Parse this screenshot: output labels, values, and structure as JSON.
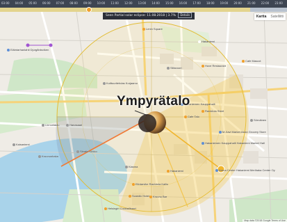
{
  "timeline": {
    "ticks": [
      "03:00",
      "04:00",
      "05:00",
      "06:00",
      "07:00",
      "08:00",
      "09:00",
      "10:00",
      "11:00",
      "12:00",
      "13:00",
      "14:00",
      "15:00",
      "16:00",
      "17:00",
      "18:00",
      "19:00",
      "20:00",
      "21:00",
      "22:00",
      "23:00"
    ],
    "position": 0.31
  },
  "eclipse": {
    "text": "Seen Partial solar eclipse: 11.08.2018 | 3.7%",
    "button": "Details"
  },
  "map_type": {
    "map": "Kartta",
    "satellite": "Satelliitti"
  },
  "place_title": "Ympyrätalo",
  "attribution": "Map data ©2018 Google  Terms of Use",
  "pois": [
    {
      "name": "Lenin Square",
      "color": "#f0a02c"
    },
    {
      "name": "Hakaniemi",
      "color": "#ffffff"
    },
    {
      "name": "Cafe Mascot",
      "color": "#f0a02c"
    },
    {
      "name": "Siltavuori",
      "color": "#999"
    },
    {
      "name": "Huve Restaurant",
      "color": "#f0a02c"
    },
    {
      "name": "Kulttuuritehdas Korjaamo",
      "color": "#999"
    },
    {
      "name": "Hakaniemen Kauppahalli",
      "color": "#5e8fd6"
    },
    {
      "name": "Cafe Talo",
      "color": "#f0a02c"
    },
    {
      "name": "Ravintola Steet",
      "color": "#f0a02c"
    },
    {
      "name": "Sörnäinen",
      "color": "#999"
    },
    {
      "name": "M-Xavi Market Asian Grocery Store",
      "color": "#5e8fd6"
    },
    {
      "name": "Hakaniemen Kauppahalli Hakaniemi Market Hall",
      "color": "#5e8fd6"
    },
    {
      "name": "Arena Center Hakaniemi Merihaka Center Oy",
      "color": "#5e8fd6"
    },
    {
      "name": "Hakaniemi",
      "color": "#f0a02c"
    },
    {
      "name": "Kruununhaka",
      "color": "#999"
    },
    {
      "name": "Linnunlaulu",
      "color": "#999"
    },
    {
      "name": "Kiasma",
      "color": "#999"
    },
    {
      "name": "Elintarvike Ravintola Kallio",
      "color": "#f0a02c"
    },
    {
      "name": "Scandic Hotel",
      "color": "#f0a02c"
    },
    {
      "name": "Helsingin Cocktailbaari",
      "color": "#f0a02c"
    },
    {
      "name": "Kruunu Bar",
      "color": "#f0a02c"
    },
    {
      "name": "Sitratie Kirkko",
      "color": "#999"
    },
    {
      "name": "Hanasaari",
      "color": "#999"
    },
    {
      "name": "Kaisaniemi",
      "color": "#999"
    },
    {
      "name": "Eläintarhanlahti Djurgårdsviken",
      "color": "#5e8fd6"
    },
    {
      "name": "Linnanmäki Helsingin Fonogrammi",
      "color": "#9a3ec2"
    }
  ]
}
